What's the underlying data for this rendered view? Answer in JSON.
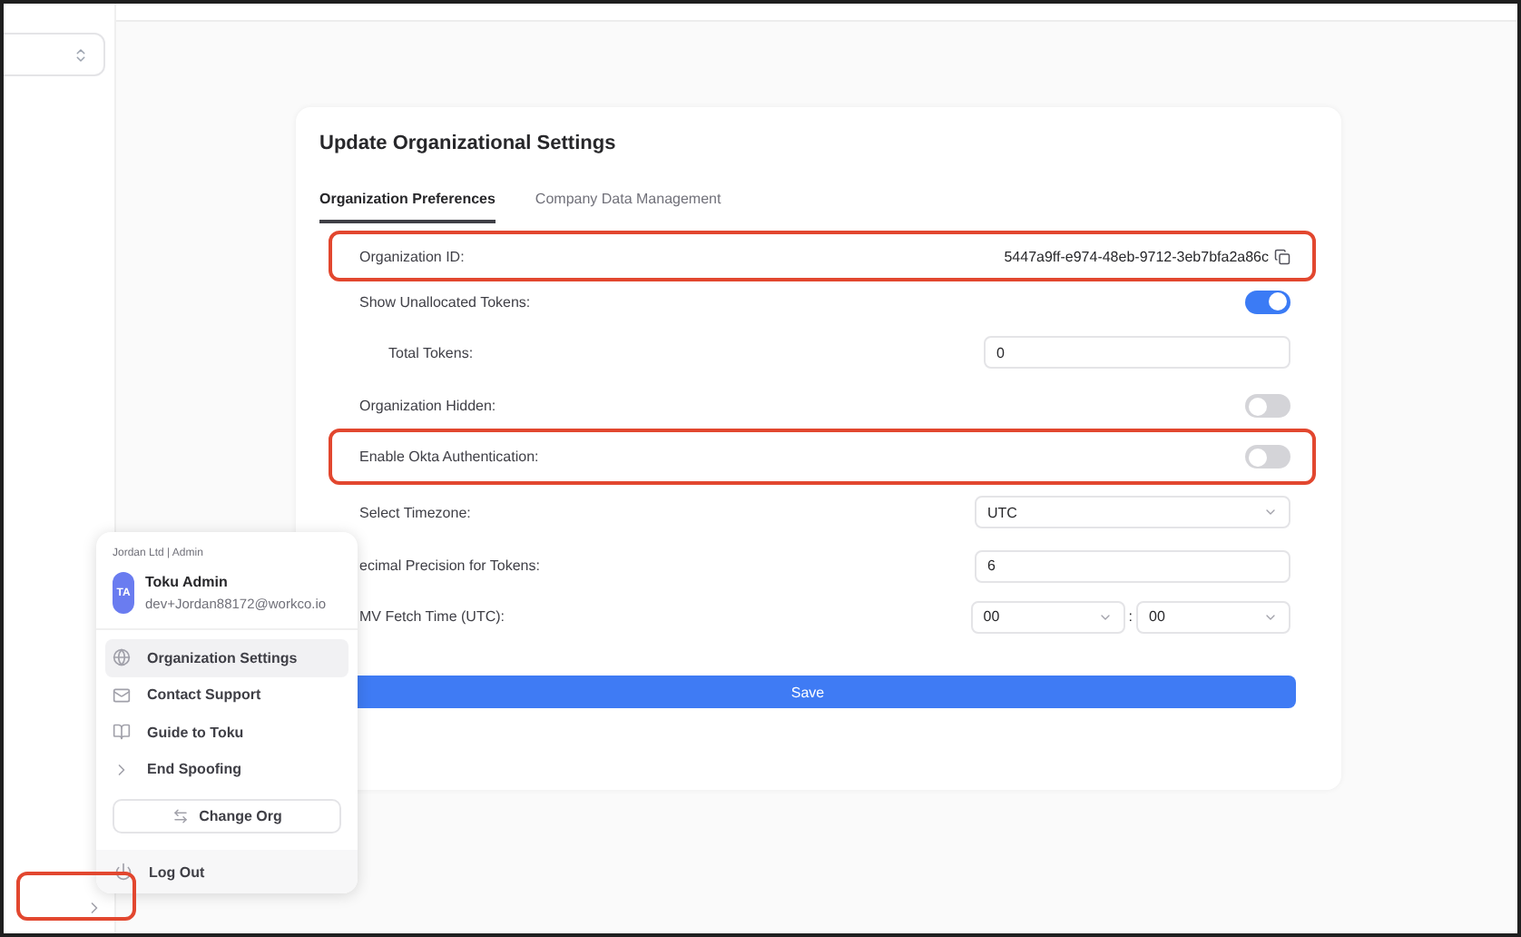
{
  "sidebar": {
    "collapse_toggle": {
      "highlighted": true
    }
  },
  "settings": {
    "title": "Update Organizational Settings",
    "tabs": [
      {
        "label": "Organization Preferences",
        "selected": true
      },
      {
        "label": "Company Data Management",
        "selected": false
      }
    ],
    "fields": [
      {
        "kind": "copy",
        "label": "Organization ID:",
        "value": "5447a9ff-e974-48eb-9712-3eb7bfa2a86c",
        "highlighted": true
      },
      {
        "kind": "switch",
        "label": "Show Unallocated Tokens:",
        "on": true,
        "children": [
          {
            "kind": "input",
            "label": "Total Tokens:",
            "value": "0"
          }
        ]
      },
      {
        "kind": "switch",
        "label": "Organization Hidden:",
        "on": false
      },
      {
        "kind": "switch",
        "label": "Enable Okta Authentication:",
        "on": false,
        "highlighted": true
      },
      {
        "kind": "select",
        "label": "Select Timezone:",
        "value": "UTC"
      },
      {
        "kind": "input",
        "label": "ecimal Precision for Tokens:",
        "value": "6"
      },
      {
        "kind": "time",
        "label": "MV Fetch Time (UTC):",
        "values": [
          "00",
          "00"
        ],
        "separator": ":"
      }
    ],
    "save": "Save"
  },
  "account_menu": {
    "org_line": "Jordan Ltd | Admin",
    "avatar": "TA",
    "name": "Toku Admin",
    "email": "dev+Jordan88172@workco.io",
    "items": [
      {
        "kind": "globe",
        "label": "Organization Settings",
        "selected": true
      },
      {
        "kind": "mail",
        "label": "Contact Support",
        "selected": false
      },
      {
        "kind": "book",
        "label": "Guide to Toku",
        "selected": false
      },
      {
        "kind": "chevron",
        "label": "End Spoofing",
        "selected": false
      }
    ],
    "change_org": "Change Org",
    "logout": "Log Out"
  }
}
